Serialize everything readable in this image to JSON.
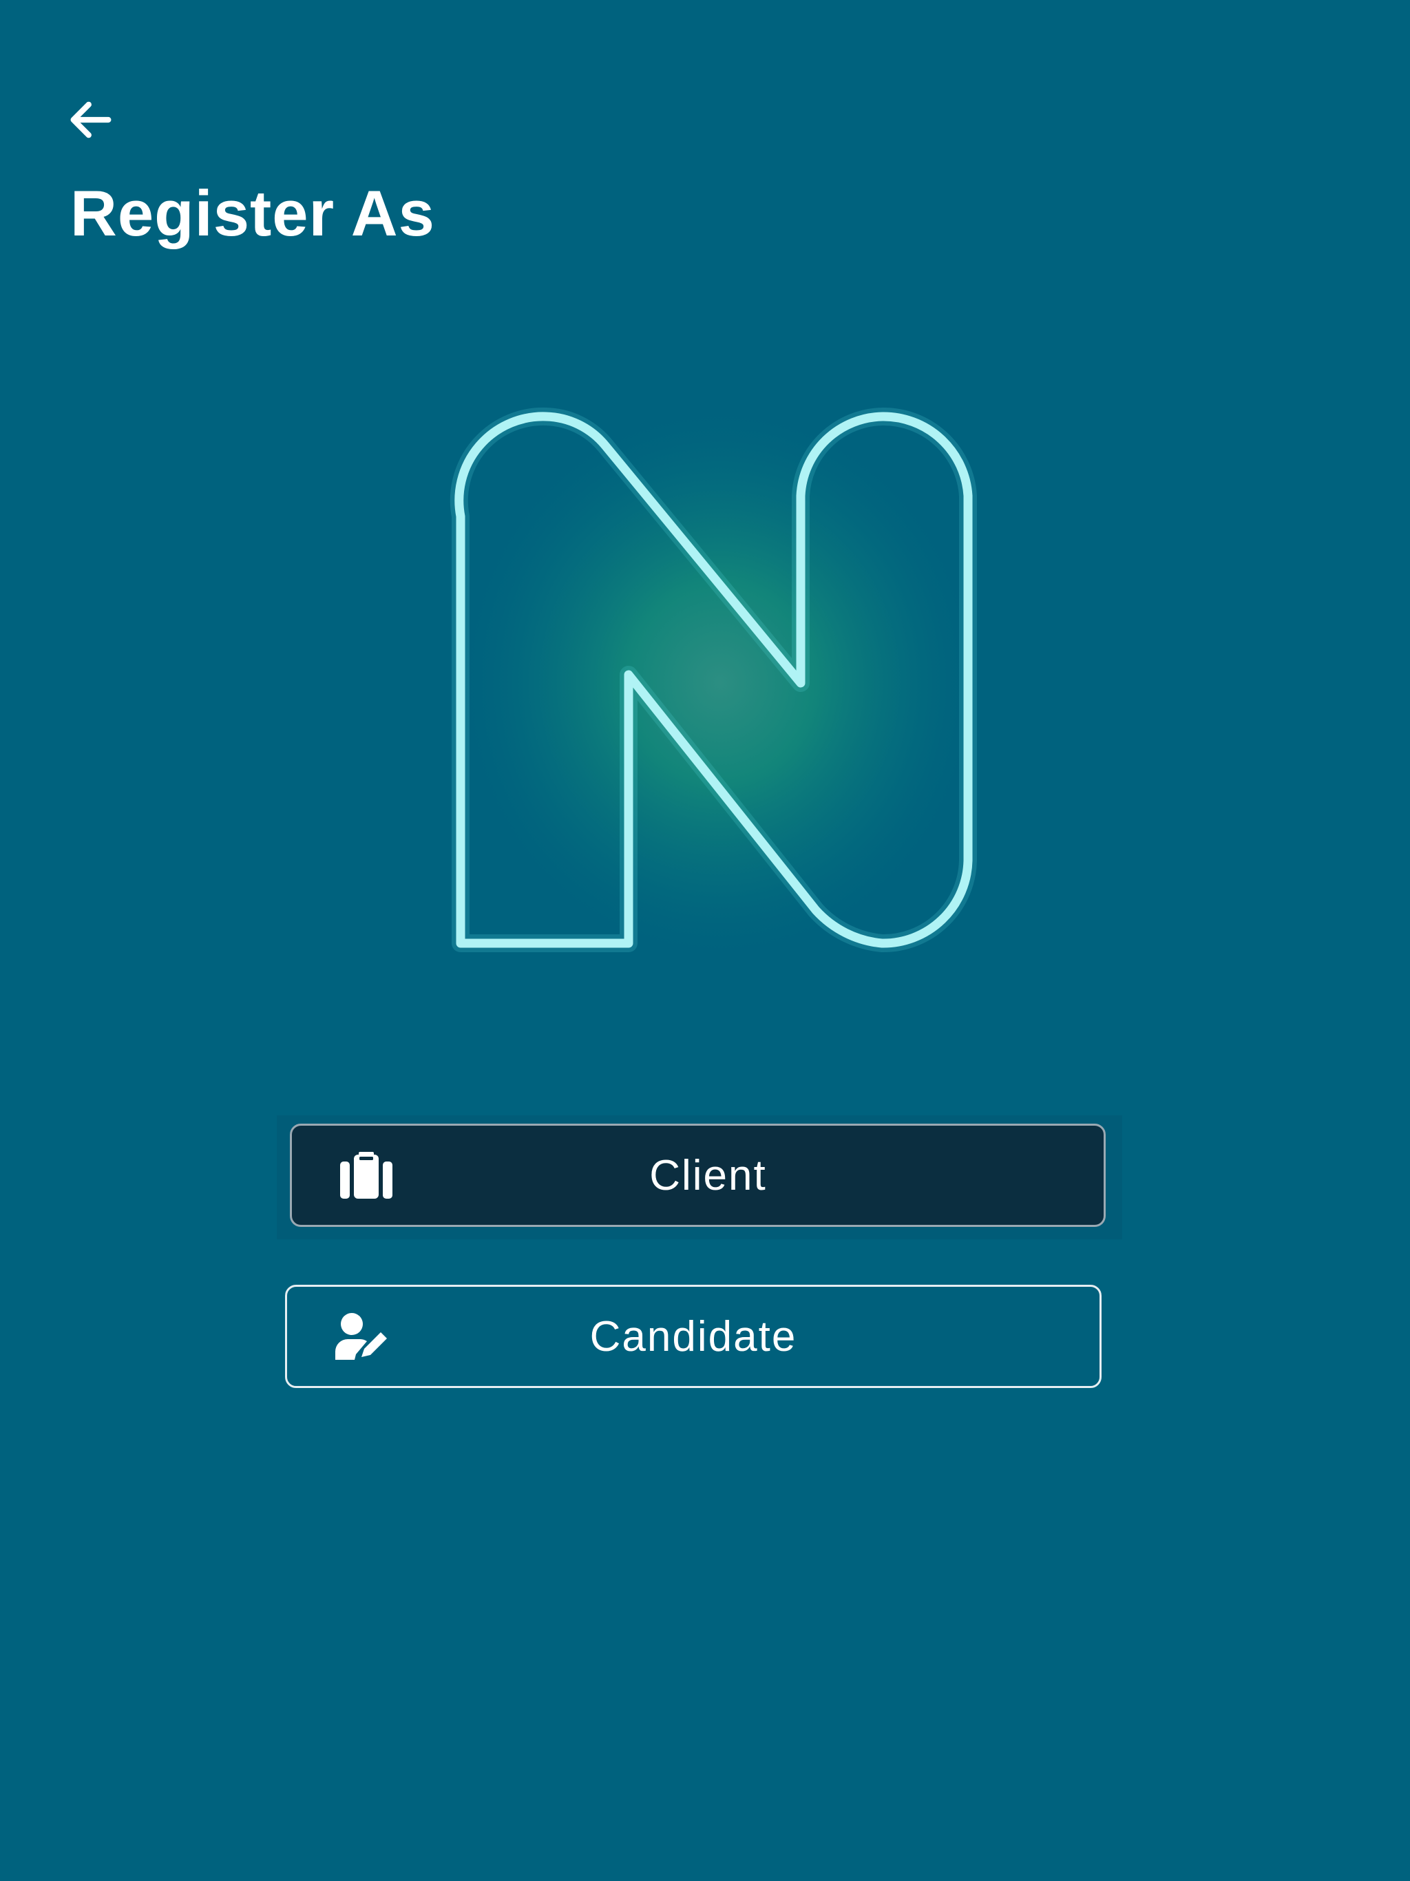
{
  "header": {
    "back_icon": "arrow-left-icon",
    "title": "Register As"
  },
  "logo": {
    "icon": "n-logo-outline",
    "stroke_color": "#b8f4f6",
    "glow_color": "#2a9a84"
  },
  "roles": [
    {
      "label": "Client",
      "icon": "briefcase-icon",
      "selected": true
    },
    {
      "label": "Candidate",
      "icon": "user-edit-icon",
      "selected": false
    }
  ],
  "colors": {
    "background": "#00627e",
    "selected_button": "#0b2e40",
    "text": "#ffffff"
  }
}
